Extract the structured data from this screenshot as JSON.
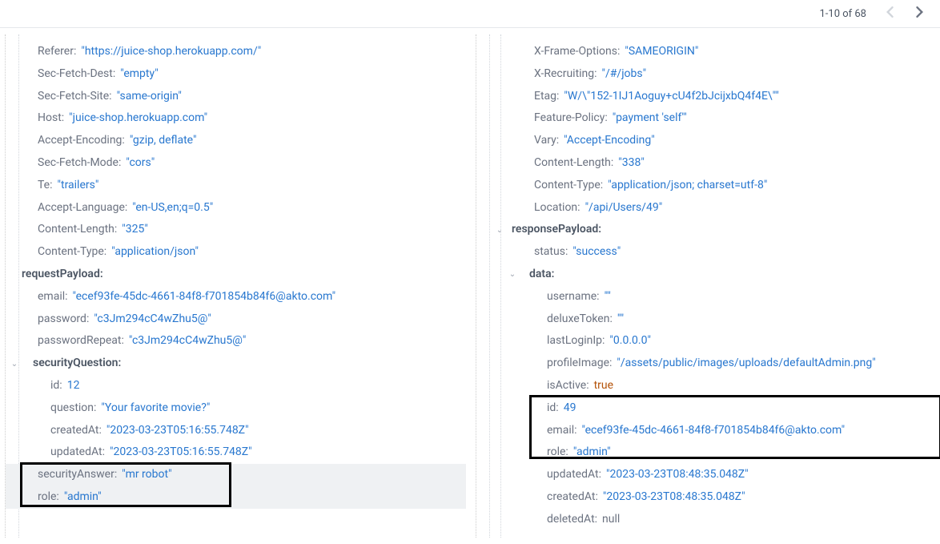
{
  "pagination": {
    "text": "1-10 of 68"
  },
  "left": {
    "headers": [
      {
        "k": "Referer:",
        "v": "\"https://juice-shop.herokuapp.com/\""
      },
      {
        "k": "Sec-Fetch-Dest:",
        "v": "\"empty\""
      },
      {
        "k": "Sec-Fetch-Site:",
        "v": "\"same-origin\""
      },
      {
        "k": "Host:",
        "v": "\"juice-shop.herokuapp.com\""
      },
      {
        "k": "Accept-Encoding:",
        "v": "\"gzip, deflate\""
      },
      {
        "k": "Sec-Fetch-Mode:",
        "v": "\"cors\""
      },
      {
        "k": "Te:",
        "v": "\"trailers\""
      },
      {
        "k": "Accept-Language:",
        "v": "\"en-US,en;q=0.5\""
      },
      {
        "k": "Content-Length:",
        "v": "\"325\""
      },
      {
        "k": "Content-Type:",
        "v": "\"application/json\""
      }
    ],
    "requestPayloadLabel": "requestPayload:",
    "payload": [
      {
        "k": "email:",
        "v": "\"ecef93fe-45dc-4661-84f8-f701854b84f6@akto.com\""
      },
      {
        "k": "password:",
        "v": "\"c3Jm294cC4wZhu5@\""
      },
      {
        "k": "passwordRepeat:",
        "v": "\"c3Jm294cC4wZhu5@\""
      }
    ],
    "securityQuestionLabel": "securityQuestion:",
    "securityQuestion": [
      {
        "k": "id:",
        "v": "12"
      },
      {
        "k": "question:",
        "v": "\"Your favorite movie?\""
      },
      {
        "k": "createdAt:",
        "v": "\"2023-03-23T05:16:55.748Z\""
      },
      {
        "k": "updatedAt:",
        "v": "\"2023-03-23T05:16:55.748Z\""
      }
    ],
    "securityAnswer": {
      "k": "securityAnswer:",
      "v": "\"mr robot\""
    },
    "role": {
      "k": "role:",
      "v": "\"admin\""
    }
  },
  "right": {
    "headers": [
      {
        "k": "X-Frame-Options:",
        "v": "\"SAMEORIGIN\""
      },
      {
        "k": "X-Recruiting:",
        "v": "\"/#/jobs\""
      },
      {
        "k": "Etag:",
        "v": "\"W/\\\"152-1IJ1Aoguy+cU4f2bJcijxbQ4f4E\\\"\""
      },
      {
        "k": "Feature-Policy:",
        "v": "\"payment 'self'\""
      },
      {
        "k": "Vary:",
        "v": "\"Accept-Encoding\""
      },
      {
        "k": "Content-Length:",
        "v": "\"338\""
      },
      {
        "k": "Content-Type:",
        "v": "\"application/json; charset=utf-8\""
      },
      {
        "k": "Location:",
        "v": "\"/api/Users/49\""
      }
    ],
    "responsePayloadLabel": "responsePayload:",
    "status": {
      "k": "status:",
      "v": "\"success\""
    },
    "dataLabel": "data:",
    "data1": [
      {
        "k": "username:",
        "v": "\"\""
      },
      {
        "k": "deluxeToken:",
        "v": "\"\""
      },
      {
        "k": "lastLoginIp:",
        "v": "\"0.0.0.0\""
      },
      {
        "k": "profileImage:",
        "v": "\"/assets/public/images/uploads/defaultAdmin.png\""
      },
      {
        "k": "isActive:",
        "v": "true",
        "type": "bool"
      }
    ],
    "boxed": [
      {
        "k": "id:",
        "v": "49"
      },
      {
        "k": "email:",
        "v": "\"ecef93fe-45dc-4661-84f8-f701854b84f6@akto.com\""
      },
      {
        "k": "role:",
        "v": "\"admin\""
      }
    ],
    "data2": [
      {
        "k": "updatedAt:",
        "v": "\"2023-03-23T08:48:35.048Z\""
      },
      {
        "k": "createdAt:",
        "v": "\"2023-03-23T08:48:35.048Z\""
      },
      {
        "k": "deletedAt:",
        "v": "null",
        "type": "null"
      }
    ]
  }
}
